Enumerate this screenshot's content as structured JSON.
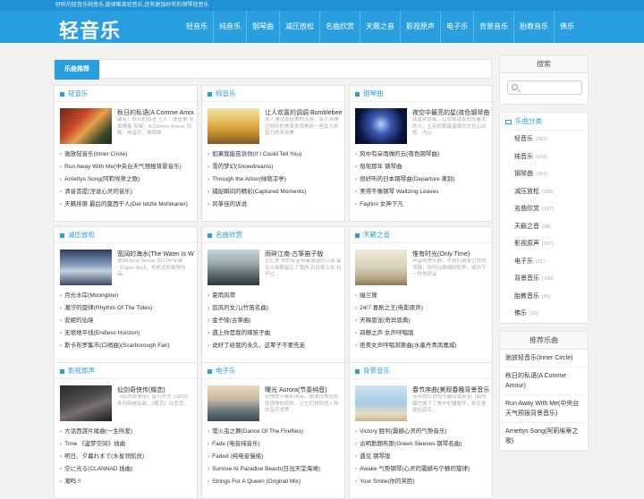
{
  "topbar": {
    "text": "好听的轻音乐纯音乐,旋律唯美轻音乐,还有更加好听的钢琴轻音乐"
  },
  "logo": "轻音乐",
  "nav": [
    "轻音乐",
    "纯音乐",
    "钢琴曲",
    "减压放松",
    "名曲欣赏",
    "天籁之音",
    "影视原声",
    "电子乐",
    "背景音乐",
    "胎教音乐",
    "佛乐"
  ],
  "recommend": {
    "tab": "乐曲推荐"
  },
  "cards": [
    {
      "title": "轻音乐",
      "feat_title": "秋日的私语(A Comme Amour)",
      "feat_desc": "曲名：秋日的私语 艺人：理查德·克莱德曼 专辑：A Comme Amour 风格：纯音乐、钢琴曲",
      "thumb": "autumn",
      "items": [
        "驰放轻音乐(Inner Circle)",
        "Run Away With Me(中央台天气预报背景音乐)",
        "Arriettys Song(阿莉埃蒂之歌)",
        "清音菩提(涅说心灵的音乐)",
        "天籁排萧 最后的莫西干人(Der letzte Mohikaner)"
      ]
    },
    {
      "title": "纯音乐",
      "feat_title": "让人欢喜的调调 Bumblebee",
      "feat_desc": "男人通过发现美的灵感，女人则通过倾听的美来发现美丽一些女人的智力的来到美",
      "thumb": "girl",
      "items": [
        "如果我能告诉你(If I Could Tell You)",
        "雪的梦幻(Snowdreams)",
        "Through the Arbor(绿荫凉亭)",
        "捕捉瞬间的精彩(Captured Moments)",
        "风筝佳的诉说"
      ]
    },
    {
      "title": "钢琴曲",
      "feat_title": "夜空中最亮的星(夜色钢琴曲)",
      "feat_desc": "我曾梦想着，心中那涌现的光着发的人，生存的那最温柔的文化心四叙，内心",
      "thumb": "night",
      "items": [
        "风中有朵雨做的云(夜色钢琴曲)",
        "匆匆那年 钢琴曲",
        "很好听的日本钢琴曲(Departure 离别)",
        "美得不像钢琴 Waltzing Leaves",
        "Faylinn 女神下凡"
      ]
    },
    {
      "title": "减压放松",
      "feat_title": "宽阔的海水(The Water Is Wide)",
      "feat_desc": "选自David Nevue 2013年专辑《Open Sky》，肖邦式的钢琴作品。",
      "thumb": "sky",
      "items": [
        "月光水岸(Moonglow)",
        "潮汐的旋律(Rhythm Of The Tides)",
        "安妮的仙境",
        "无垠地平线(Endless Horizon)",
        "斯卡布罗集市(口哨曲)(Scarborough Fair)"
      ]
    },
    {
      "title": "名曲欣赏",
      "feat_title": "雨碎江南-古筝笛子版",
      "feat_desc": "记忆里 你的足音带着潮湿的江南 留住义缘飘留忘了我的 石径那么长 长不过...",
      "thumb": "rain",
      "items": [
        "夏雨风荷",
        "追风的女儿(竹笛名曲)",
        "金子陵(古筝曲)",
        "遇上你是我的缘笛子曲",
        "说好了给我的永久，这辈子不要先走"
      ]
    },
    {
      "title": "天籁之音",
      "feat_title": "惟有时光(Only Time)",
      "feat_desc": "声音纯美安静，方我们满漾尘世的浮躁，你可以细细的聆声，或许下一秒你就会",
      "thumb": "woman",
      "items": [
        "幽兰操",
        "24/7 喜剧之王(电影原声)",
        "天赐恩宠(奇异恩典)",
        "寂静之声 女声哼唱版",
        "绝美女声哼唱洞箫曲(水墨丹青凤凰城)"
      ]
    },
    {
      "title": "影视原声",
      "feat_title": "仙剑奇侠传(蝶恋)",
      "feat_desc": "《仙剑奇侠传》音乐作为《仙剑》系列传统名曲，《蝶恋》在恋恋...",
      "thumb": "dark",
      "items": [
        "大话西游片尾曲(一生所爱)",
        "Time 《盗梦空间》插曲",
        "明日、夕暮れまで(水星领航员)",
        "空に光る(CLANNAD 插曲)",
        "潮吗 !!"
      ]
    },
    {
      "title": "电子乐",
      "feat_title": "曙光 Aurora(节奏纯音)",
      "feat_desc": "轻快的节奏和清亮，旋律优美轻松和感情的同时，让它们领你进入你的音乐世界...",
      "thumb": "lake",
      "items": [
        "萤火虫之舞(Dance Of The Fireflies)",
        "Fade (电音纯音乐)",
        "Faded (纯电音慢摇)",
        "Sunrise At Paradise Beach(日出天堂海滩)",
        "Strings For A Queen (Original Mix)"
      ]
    },
    {
      "title": "背景音乐",
      "feat_title": "春节序曲(美观春晚背景音乐)",
      "feat_desc": "连年的红包包与春回我来至门前的爆竹放下了美中的铺展开，欢乐更是在民乐...",
      "thumb": "beach",
      "items": [
        "Victory 胜利(震撼心灵的气势音乐)",
        "古明斯朗布斯(Green Sleeves 钢琴名曲)",
        "遇见 钢琴版",
        "Awake 气势钢琴(心灵的震撼与宁静的旋律)",
        "Your Smile(你的笑脸)"
      ]
    }
  ],
  "sidebar": {
    "search_title": "搜索",
    "search_placeholder": "",
    "category_title": "乐曲分类",
    "categories": [
      {
        "name": "轻音乐",
        "count": "(352)"
      },
      {
        "name": "纯音乐",
        "count": "(143)"
      },
      {
        "name": "钢琴曲",
        "count": "(267)"
      },
      {
        "name": "减压放松",
        "count": "(105)"
      },
      {
        "name": "名曲欣赏",
        "count": "(137)"
      },
      {
        "name": "天籁之音",
        "count": "(38)"
      },
      {
        "name": "影视原声",
        "count": "(107)"
      },
      {
        "name": "电子乐",
        "count": "(31)"
      },
      {
        "name": "背景音乐",
        "count": "(106)"
      },
      {
        "name": "胎教音乐",
        "count": "(56)"
      },
      {
        "name": "佛乐",
        "count": "(33)"
      }
    ],
    "rec_title": "推荐乐曲",
    "rec_items": [
      "驰放轻音乐(Inner Circle)",
      "秋日的私语(A Comme Amour)",
      "Run Away With Me(中央台天气预报背景音乐)",
      "Arriettys Song(阿莉埃蒂之歌)"
    ]
  },
  "colors": {
    "accent": "#2a9fe0",
    "topbar": "#1f91d3"
  }
}
